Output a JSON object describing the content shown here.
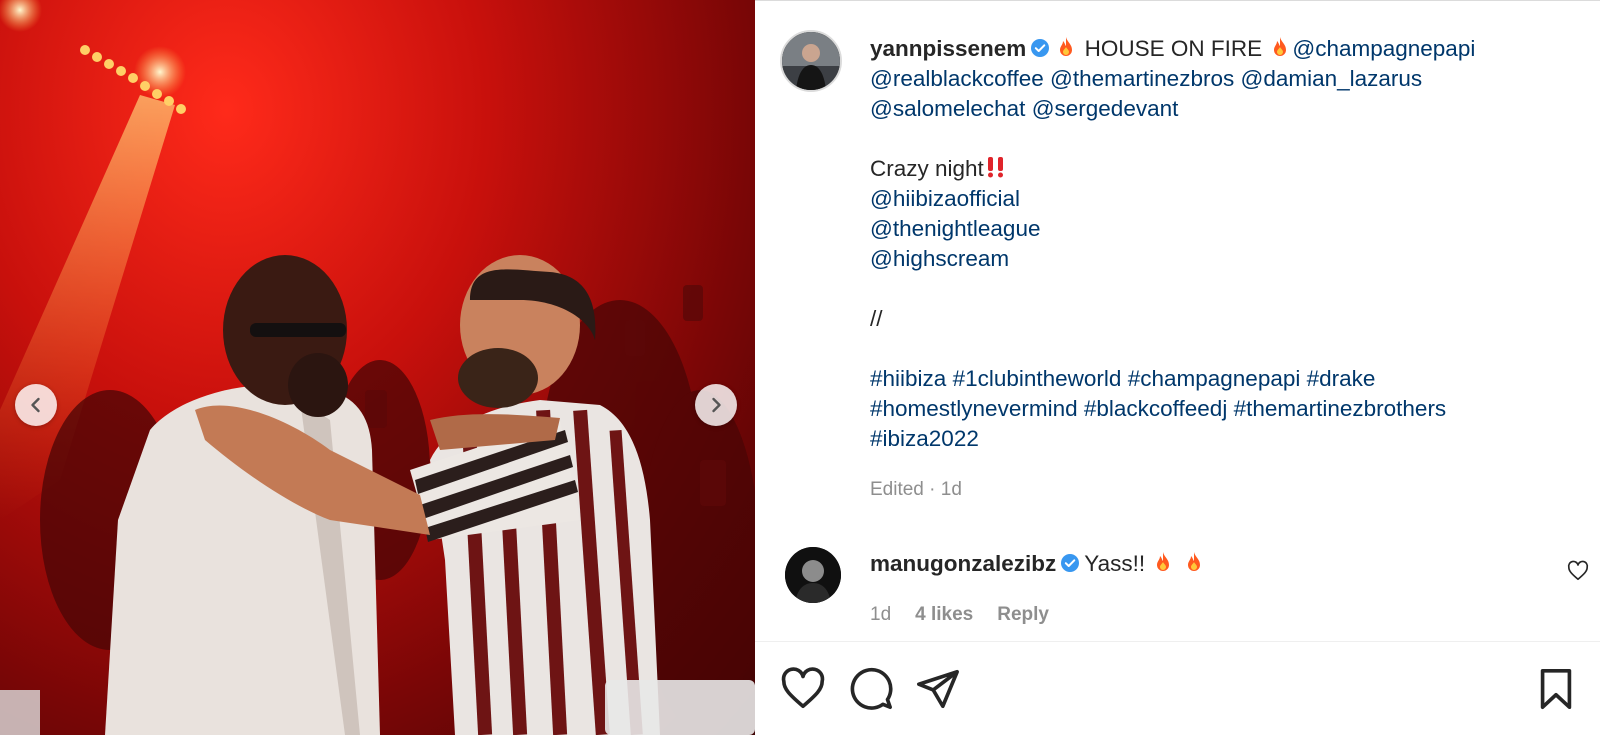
{
  "post": {
    "author": {
      "username": "yannpissenem",
      "verified": true,
      "avatar_icon": "profile-avatar"
    },
    "caption": {
      "headline_text": " HOUSE ON FIRE ",
      "headline_mentions": [
        "@champagnepapi"
      ],
      "mentions_line2": [
        "@realblackcoffee",
        "@themartinezbros",
        "@damian_lazarus"
      ],
      "mentions_line3": [
        "@salomelechat",
        "@sergedevant"
      ],
      "crazy_night": "Crazy night",
      "tags_list": [
        "@hiibiza​official",
        "@thenightleague",
        "@highscream"
      ],
      "separator": "//",
      "hashtags_line1": [
        "#hiibiza",
        "#1clubintheworld",
        "#champagnepapi",
        "#drake"
      ],
      "hashtags_line2": [
        "#homestlynevermind",
        "#blackcoffeedj",
        "#themartinezbrothers"
      ],
      "hashtags_line3": [
        "#ibiza2022"
      ]
    },
    "edited": "Edited",
    "time_ago": "1d"
  },
  "comment": {
    "username": "manugonzalezibz",
    "verified": true,
    "text": "Yass!! ",
    "time": "1d",
    "likes": "4 likes",
    "reply": "Reply"
  },
  "media": {
    "description_icon": "photo",
    "nav": {
      "prev_icon": "chevron-left-icon",
      "next_icon": "chevron-right-icon"
    }
  },
  "actions": [
    "heart-icon",
    "comment-icon",
    "share-icon",
    "bookmark-icon"
  ],
  "colors": {
    "link": "#00376b",
    "text": "#262626",
    "muted": "#8e8e8e",
    "verified": "#3897f0",
    "fire": "#ff5a1f",
    "border": "#dbdbdb"
  }
}
